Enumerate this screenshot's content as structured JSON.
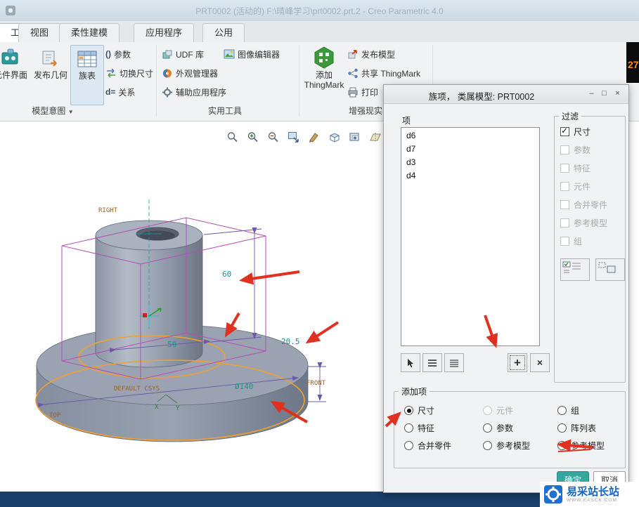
{
  "window": {
    "title": "PRT0002 (活动的) F:\\晴峰学习\\prt0002.prt.2 - Creo Parametric 4.0"
  },
  "tabs": {
    "partial": "工具",
    "items": [
      "视图",
      "柔性建模",
      "应用程序",
      "公用"
    ]
  },
  "ribbon": {
    "component_interface": "元件界面",
    "publish_geometry": "发布几何",
    "family_table": "族表",
    "parameters": "参数",
    "switch_dimensions": "切换尺寸",
    "relations": "关系",
    "udf_library": "UDF 库",
    "image_editor": "图像编辑器",
    "appearance_manager": "外观管理器",
    "aux_applications": "辅助应用程序",
    "add_thingmark_line1": "添加",
    "add_thingmark_line2": "ThingMark",
    "publish_model": "发布模型",
    "share_thingmark": "共享 ThingMark",
    "print": "打印",
    "group1_label": "模型意图",
    "group2_label": "实用工具",
    "group3_label": "增强现实"
  },
  "icons": {
    "minimize": "–",
    "maximize": "□",
    "close": "×",
    "plus": "+",
    "cross": "×",
    "caret": "▼",
    "paren": "()",
    "deq": "d="
  },
  "dialog": {
    "title": "族项， 类属模型: PRT0002",
    "items_label": "项",
    "items": [
      "d6",
      "d7",
      "d3",
      "d4"
    ],
    "filter_label": "过滤",
    "filters": [
      {
        "label": "尺寸",
        "checked": true,
        "disabled": false
      },
      {
        "label": "参数",
        "checked": false,
        "disabled": true
      },
      {
        "label": "特征",
        "checked": false,
        "disabled": true
      },
      {
        "label": "元件",
        "checked": false,
        "disabled": true
      },
      {
        "label": "合并零件",
        "checked": false,
        "disabled": true
      },
      {
        "label": "参考模型",
        "checked": false,
        "disabled": true
      },
      {
        "label": "组",
        "checked": false,
        "disabled": true
      }
    ],
    "add_label": "添加项",
    "add_options": [
      {
        "label": "尺寸",
        "selected": true,
        "disabled": false
      },
      {
        "label": "元件",
        "selected": false,
        "disabled": true
      },
      {
        "label": "组",
        "selected": false,
        "disabled": false
      },
      {
        "label": "特征",
        "selected": false,
        "disabled": false
      },
      {
        "label": "参数",
        "selected": false,
        "disabled": false
      },
      {
        "label": "阵列表",
        "selected": false,
        "disabled": false
      },
      {
        "label": "合并零件",
        "selected": false,
        "disabled": false
      },
      {
        "label": "参考模型",
        "selected": false,
        "disabled": false
      },
      {
        "label": "参考模型",
        "selected": false,
        "disabled": false
      }
    ],
    "ok": "确定",
    "cancel": "取消"
  },
  "model": {
    "dims": {
      "d60": "60",
      "d205": "20.5",
      "d50": "50",
      "d140": "Ø140"
    },
    "labels": {
      "right": "RIGHT",
      "front": "FRONT",
      "top": "TOP",
      "csys": "DEFAULT CSYS",
      "x": "X",
      "y": "Y"
    }
  },
  "corner_badge": "27",
  "watermark": {
    "name": "易采站长站",
    "sub": "WWW.EASCK.COM"
  },
  "colors": {
    "arrow_red": "#e03020",
    "dim_teal": "#0e9b8f",
    "edge_orange": "#f0a030",
    "wire_purple": "#b44fb4",
    "label_brown": "#96622e"
  }
}
